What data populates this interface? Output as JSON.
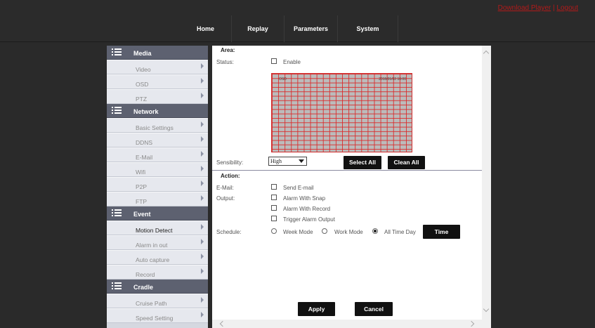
{
  "top_links": {
    "download": "Download Player",
    "separator": "|",
    "logout": "Logout"
  },
  "nav": {
    "home": "Home",
    "replay": "Replay",
    "parameters": "Parameters",
    "system": "System"
  },
  "sidebar": {
    "media": {
      "title": "Media",
      "items": [
        "Video",
        "OSD",
        "PTZ"
      ]
    },
    "network": {
      "title": "Network",
      "items": [
        "Basic Settings",
        "DDNS",
        "E-Mail",
        "Wifi",
        "P2P",
        "FTP"
      ]
    },
    "event": {
      "title": "Event",
      "items": [
        "Motion Detect",
        "Alarm in out",
        "Auto capture",
        "Record"
      ],
      "active": "Motion Detect"
    },
    "cradle": {
      "title": "Cradle",
      "items": [
        "Cruise Path",
        "Speed Setting"
      ]
    }
  },
  "area": {
    "heading": "Area:",
    "status_label": "Status:",
    "enable_label": "Enable",
    "enable_checked": false,
    "grid_overlay_left": "OSD",
    "grid_overlay_right": "2018/01/02 10:00",
    "sensitivity_label": "Sensibility:",
    "sensitivity_value": "High",
    "select_all": "Select All",
    "clean_all": "Clean All"
  },
  "action": {
    "heading": "Action:",
    "email_label": "E-Mail:",
    "send_email": "Send E-mail",
    "output_label": "Output:",
    "alarm_snap": "Alarm With Snap",
    "alarm_record": "Alarm With Record",
    "trigger_output": "Trigger Alarm Output",
    "schedule_label": "Schedule:",
    "week_mode": "Week Mode",
    "work_mode": "Work Mode",
    "all_time_day": "All Time Day",
    "selected_schedule": "All Time Day",
    "time_button": "Time"
  },
  "buttons": {
    "apply": "Apply",
    "cancel": "Cancel"
  },
  "colors": {
    "topbar": "#2b2b2b",
    "link": "#b21a1a",
    "section_header": "#5d6170",
    "grid_line": "#dc2828",
    "button": "#111111"
  }
}
